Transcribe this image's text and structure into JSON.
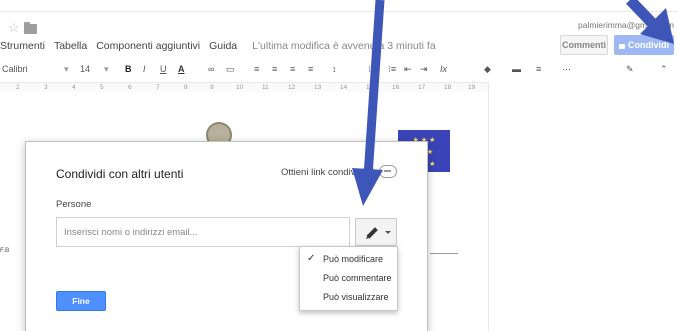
{
  "header": {
    "email": "palmierimma@gmail.com",
    "star_glyph": "☆",
    "comments_label": "Commenti",
    "share_label": "Condividi"
  },
  "menu": {
    "items": [
      "Strumenti",
      "Tabella",
      "Componenti aggiuntivi",
      "Guida"
    ],
    "last_edit": "L'ultima modifica è avvenuta 3 minuti fa"
  },
  "toolbar": {
    "font": "Calibri",
    "font_caret": "▾",
    "size": "14",
    "size_caret": "▾",
    "bold": "B",
    "italic": "I",
    "underline": "U",
    "text_color": "A",
    "link": "∞",
    "comment": "▭",
    "align_left": "≡",
    "align_center": "≡",
    "align_right": "≡",
    "justify": "≡",
    "line_spacing": "↕",
    "numbered_list": "⁝≡",
    "bulleted_list": "⁝≡",
    "decrease_indent": "⇤",
    "increase_indent": "⇥",
    "clear_format": "Ix",
    "fill_color": "◆",
    "line_color": "▬",
    "line_weight": "≡",
    "line_dash": "⋯",
    "edit_mode": "✎",
    "collapse": "⌃"
  },
  "ruler": {
    "marks": [
      "2",
      "3",
      "4",
      "5",
      "6",
      "7",
      "8",
      "9",
      "10",
      "11",
      "12",
      "13",
      "14",
      "15",
      "16",
      "17",
      "18",
      "19"
    ]
  },
  "document": {
    "side_text": "F.B",
    "eu_stars": "★ ★ ★\n★   ★\n★ ★ ★"
  },
  "dialog": {
    "title": "Condividi con altri utenti",
    "get_link": "Ottieni link condivisibile",
    "people_label": "Persone",
    "input_placeholder": "Inserisci nomi o indirizzi email...",
    "done_label": "Fine"
  },
  "permissions": {
    "selected": "Può modificare",
    "options": [
      "Può modificare",
      "Può commentare",
      "Può visualizzare"
    ],
    "check": "✓"
  },
  "colors": {
    "share_button": "#9db8f3",
    "done_button": "#4d90fe",
    "arrow": "#3d56b8",
    "eu_flag": "#3a44b8"
  }
}
